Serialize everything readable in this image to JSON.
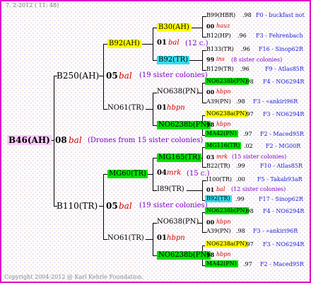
{
  "header": "7.  2-2012 ( 11: 48)",
  "footer": "Copyright 2004-2012 @ Karl Kehrle Foundation.",
  "root": {
    "name": "B46(AH)",
    "year": "08",
    "mating": "bal",
    "note": "(Drones from 15 sister colonies)"
  },
  "gen1": [
    {
      "name": "B250(AH)",
      "year": "05",
      "mating": "bal",
      "note": "(19 sister colonies)"
    },
    {
      "name": "B110(TR)",
      "year": "05",
      "mating": "bal",
      "note": "(19 sister colonies)"
    }
  ],
  "gen2": [
    {
      "name": "B92(AH)",
      "year": "01",
      "mating": "bal",
      "note": "(12 c.)"
    },
    {
      "name": "NO61(TR)",
      "year": "01",
      "mating": "hbpn",
      "note": ""
    },
    {
      "name": "MG60(TR)",
      "year": "04",
      "mating": "mrk",
      "note": "(15 c.)"
    },
    {
      "name": "NO61(TR)",
      "year": "01",
      "mating": "hbpn",
      "note": ""
    }
  ],
  "gen3": [
    {
      "name": "B30(AH)",
      "year": "00",
      "mating": "hauz",
      "note": ""
    },
    {
      "name": "B92(TR)",
      "year": "99",
      "mating": "ins",
      "note": "(8 sister colonies)"
    },
    {
      "name": "NO638(PN)",
      "year": "00",
      "mating": "hbpn",
      "note": ""
    },
    {
      "name": "NO6238b(PN)",
      "year": "98",
      "mating": "hbpn",
      "note": ""
    },
    {
      "name": "MG165(TR)",
      "year": "03",
      "mating": "mrk",
      "note": "(15 sister colonies)"
    },
    {
      "name": "I89(TR)",
      "year": "01",
      "mating": "bal",
      "note": "(12 sister colonies)"
    },
    {
      "name": "NO638(PN)",
      "year": "00",
      "mating": "hbpn",
      "note": ""
    },
    {
      "name": "NO6238b(PN)",
      "year": "98",
      "mating": "hbpn",
      "note": ""
    }
  ],
  "gen4": [
    {
      "name": "B99(HBR)",
      "year": ".98",
      "code": "F0 - buckfast not"
    },
    {
      "name": "B12(HP)",
      "year": ".96",
      "code": "F3 - Fehrenbach"
    },
    {
      "name": "B133(TR)",
      "year": ".96",
      "code": "F16 - Sinop62R"
    },
    {
      "name": "B129(TR)",
      "year": ".96",
      "code": "F9 - Atlas85R"
    },
    {
      "name": "NO6238b(PN)",
      "year": ".98",
      "code": "F4 - NO6294R"
    },
    {
      "name": "A39(PN)",
      "year": ".98",
      "code": "F3 - «ankiri96R"
    },
    {
      "name": "NO6238a(PN)",
      "year": ".97",
      "code": "F3 - NO6294R"
    },
    {
      "name": "MA42(PN)",
      "year": ".97",
      "code": "F2 - Maced95R"
    },
    {
      "name": "MG116(TR)",
      "year": ".02",
      "code": "F2 - MG00R"
    },
    {
      "name": "B22(TR)",
      "year": ".99",
      "code": "F10 - Atlas85R"
    },
    {
      "name": "I100(TR)",
      "year": ".00",
      "code": "F5 - Takab93aR"
    },
    {
      "name": "B92(TR)",
      "year": ".99",
      "code": "F17 - Sinop62R"
    },
    {
      "name": "NO6238b(PN)",
      "year": ".98",
      "code": "F4 - NO6294R"
    },
    {
      "name": "A39(PN)",
      "year": ".98",
      "code": "F3 - «ankiri96R"
    },
    {
      "name": "NO6238a(PN)",
      "year": ".97",
      "code": "F3 - NO6294R"
    },
    {
      "name": "MA42(PN)",
      "year": ".97",
      "code": "F2 - Maced95R"
    }
  ]
}
